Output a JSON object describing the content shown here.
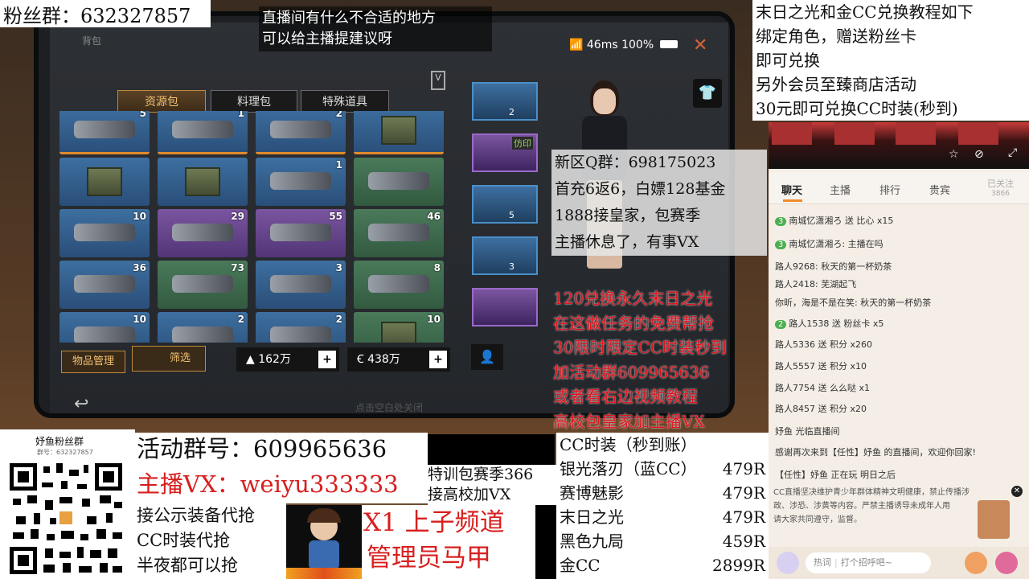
{
  "top_left_banner": "粉丝群：632327857",
  "top_center_notice": [
    "直播间有什么不合适的地方",
    "可以给主播提建议呀"
  ],
  "top_right_notice": [
    "末日之光和金CC兑换教程如下",
    "绑定角色，赠送粉丝卡",
    "即可兑换",
    "另外会员至臻商店活动",
    "30元即可兑换CC时装(秒到)"
  ],
  "game": {
    "header_title": "背包",
    "signal": "46ms",
    "battery": "100%",
    "tabs": [
      "资源包",
      "料理包",
      "特殊道具"
    ],
    "grid": [
      {
        "count": "5",
        "color": "blue"
      },
      {
        "count": "1",
        "color": "blue"
      },
      {
        "count": "2",
        "color": "blue"
      },
      {
        "count": "",
        "color": "blue"
      },
      {
        "count": "",
        "color": "blue"
      },
      {
        "count": "",
        "color": "blue"
      },
      {
        "count": "1",
        "color": "blue"
      },
      {
        "count": "",
        "color": "green"
      },
      {
        "count": "10",
        "color": "blue"
      },
      {
        "count": "29",
        "color": "purple"
      },
      {
        "count": "55",
        "color": "purple"
      },
      {
        "count": "46",
        "color": "green"
      },
      {
        "count": "36",
        "color": "blue"
      },
      {
        "count": "73",
        "color": "green"
      },
      {
        "count": "3",
        "color": "blue"
      },
      {
        "count": "8",
        "color": "green"
      },
      {
        "count": "10",
        "color": "blue"
      },
      {
        "count": "2",
        "color": "blue"
      },
      {
        "count": "2",
        "color": "blue"
      },
      {
        "count": "10",
        "color": "green"
      }
    ],
    "side_slots": [
      {
        "count": "2"
      },
      {
        "count": "",
        "label": "仿印"
      },
      {
        "count": "5"
      },
      {
        "count": "3"
      },
      {
        "count": ""
      }
    ],
    "manage_button": "物品管理",
    "filter_button": "筛选",
    "currency_a": "162万",
    "currency_b": "438万",
    "bottom_hint": "点击空白处关闭"
  },
  "mid_info": [
    "新区Q群：698175023",
    "首充6返6，白嫖128基金",
    "1888接皇家，包赛季",
    "主播休息了，有事VX"
  ],
  "red_promo": [
    "120兑换永久末日之光",
    "在这做任务的免费帮抢",
    "30限时限定CC时装秒到",
    "加活动群609965636",
    "或者看右边视频教程",
    "高校包皇家加主播VX"
  ],
  "price_list": {
    "title": "CC时装（秒到账）",
    "items": [
      {
        "name": "银光落刃（蓝CC）",
        "price": "479R"
      },
      {
        "name": "赛博魅影",
        "price": "479R"
      },
      {
        "name": "末日之光",
        "price": "479R"
      },
      {
        "name": "黑色九局",
        "price": "459R"
      },
      {
        "name": "金CC",
        "price": "2899R"
      }
    ]
  },
  "fan_group": {
    "title": "妤鱼粉丝群",
    "sub": "群号：632327857"
  },
  "activity_group": "活动群号：609965636",
  "anchor_vx": "主播VX：weiyu333333",
  "proxy_lines": [
    "接公示装备代抢",
    "CC时装代抢",
    "半夜都可以抢"
  ],
  "season_lines": [
    "特训包赛季366",
    "接高校加VX"
  ],
  "channel_lines": [
    "X1 上子频道",
    "管理员马甲"
  ],
  "chat": {
    "tabs": [
      "聊天",
      "主播",
      "排行",
      "贵宾"
    ],
    "follow": "已关注",
    "follow_count": "3866",
    "messages": [
      {
        "lvl": "3",
        "text": "南城忆潇湘ろ 送 比心 x15"
      },
      {
        "lvl": "3",
        "text": "南城忆潇湘ろ: 主播在吗"
      },
      {
        "lvl": "",
        "text": "路人9268: 秋天的第一杯奶茶"
      },
      {
        "lvl": "",
        "text": "路人2418: 芜湖起飞"
      },
      {
        "lvl": "",
        "text": "你昕，海是不是在笑: 秋天的第一杯奶茶"
      },
      {
        "lvl": "2",
        "text": "路人1538 送 粉丝卡 x5"
      },
      {
        "lvl": "",
        "text": "路人5336 送 积分 x260"
      },
      {
        "lvl": "",
        "text": "路人5557 送 积分 x10"
      },
      {
        "lvl": "",
        "text": "路人7754 送 么么哒 x1"
      },
      {
        "lvl": "",
        "text": "路人8457 送 积分 x20"
      },
      {
        "lvl": "",
        "text": "妤鱼 光临直播间"
      },
      {
        "lvl": "",
        "text": "感谢再次来到【任性】妤鱼 的直播间，欢迎你回家!"
      },
      {
        "lvl": "",
        "text": "【任性】妤鱼 正在玩 明日之后"
      }
    ],
    "policy": [
      "CC直播坚决维护青少年群体精神文明健康，禁止传播涉",
      "政、涉恐、涉黄等内容。严禁主播诱导未成年人用",
      "请大家共同遵守，监督。"
    ],
    "hotword": "热词",
    "input_placeholder": "打个招呼吧~"
  }
}
